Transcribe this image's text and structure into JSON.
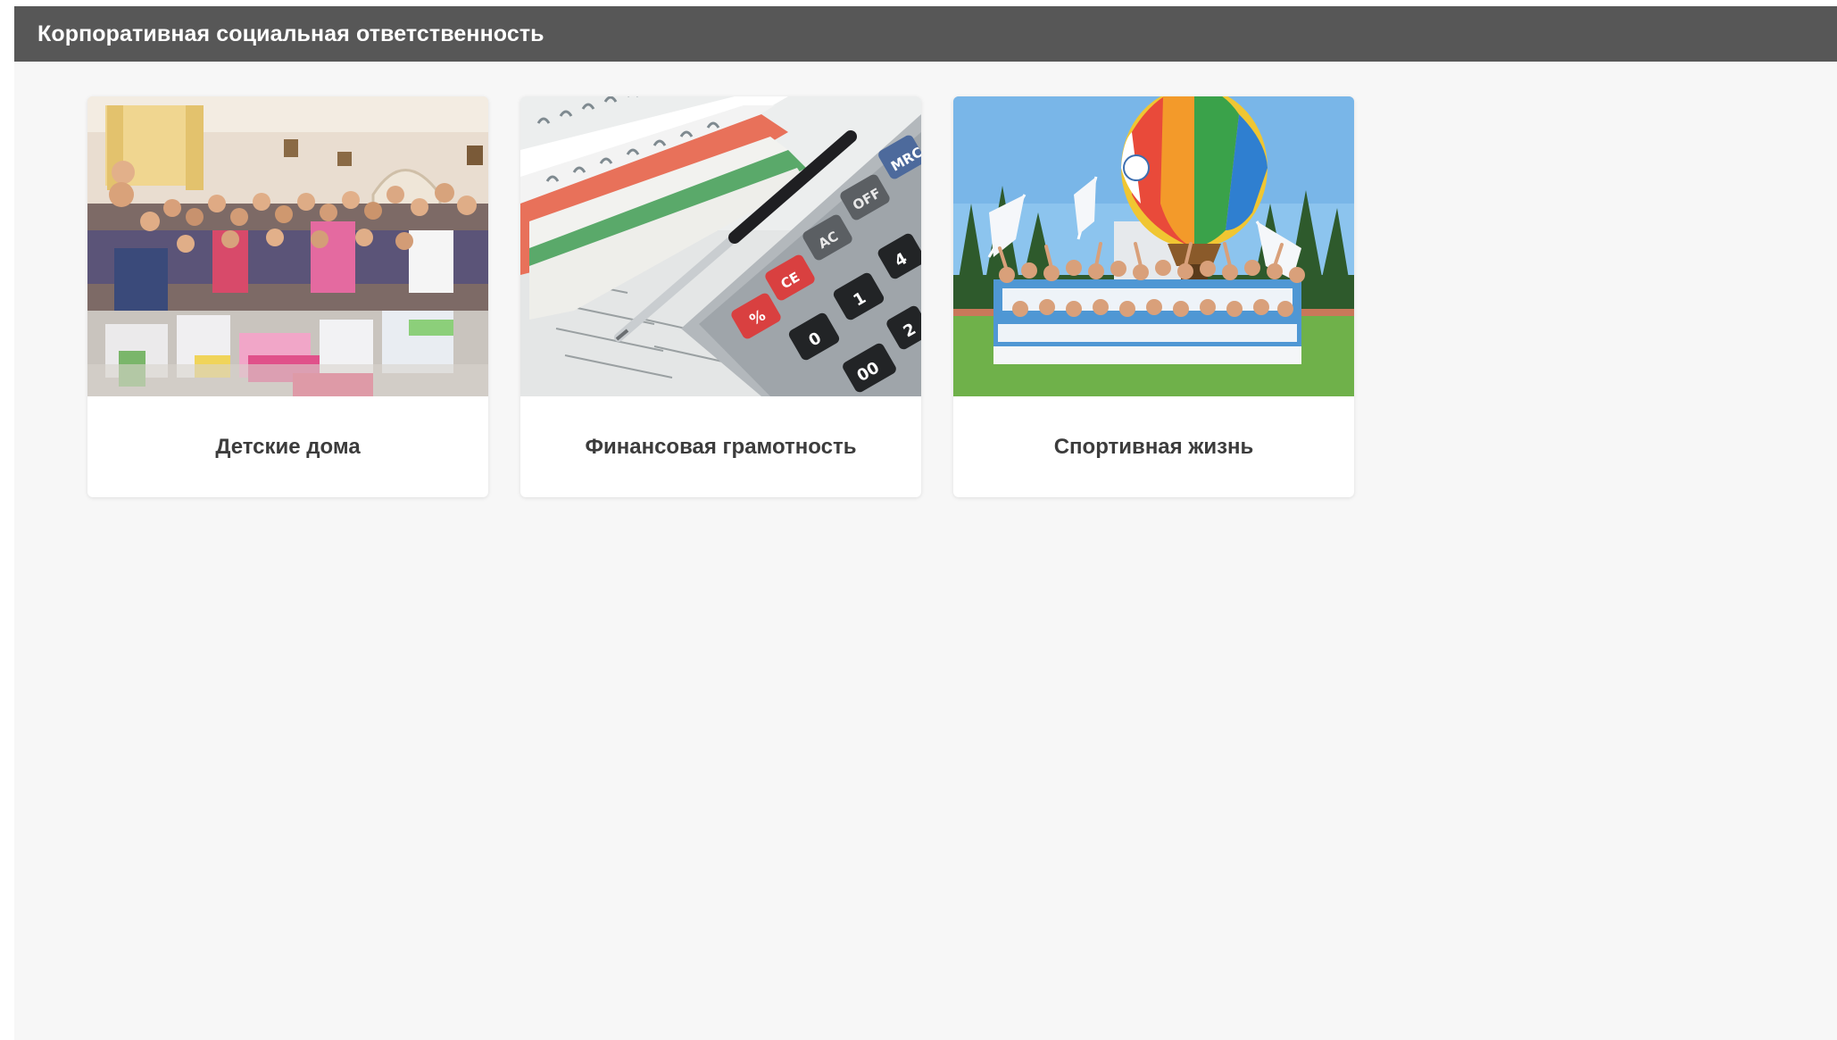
{
  "header": {
    "title": "Корпоративная социальная ответственность",
    "background_color": "#575757"
  },
  "cards": [
    {
      "label": "Детские дома",
      "image": "orphanage-group-photo"
    },
    {
      "label": "Финансовая грамотность",
      "image": "calculator-and-notebooks-photo"
    },
    {
      "label": "Спортивная жизнь",
      "image": "hot-air-balloon-sports-team-photo"
    }
  ],
  "calculator_keys": {
    "mrc": "MRC",
    "off": "OFF",
    "ac": "AC",
    "ce": "CE",
    "percent": "%",
    "k4": "4",
    "k1": "1",
    "k2": "2",
    "k0": "0",
    "k00": "00"
  },
  "colors": {
    "page_background": "#f7f7f7",
    "card_background": "#ffffff",
    "label_text": "#3c3c3c"
  }
}
